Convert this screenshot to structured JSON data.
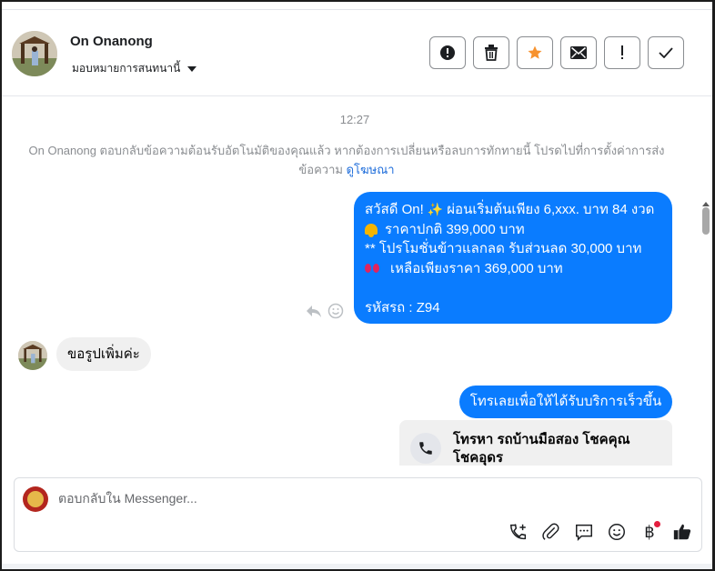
{
  "header": {
    "contact_name": "On Onanong",
    "assign_label": "มอบหมายการสนทนานี้"
  },
  "actions": [
    {
      "name": "spam-button",
      "icon": "alert-circle-icon"
    },
    {
      "name": "delete-button",
      "icon": "trash-icon"
    },
    {
      "name": "star-button",
      "icon": "star-icon"
    },
    {
      "name": "mark-unread-button",
      "icon": "envelope-icon"
    },
    {
      "name": "follow-up-button",
      "icon": "exclamation-icon"
    },
    {
      "name": "done-button",
      "icon": "checkmark-icon"
    }
  ],
  "conversation": {
    "timestamp": "12:27",
    "system_message": "On Onanong ตอบกลับข้อความต้อนรับอัตโนมัติของคุณแล้ว หากต้องการเปลี่ยนหรือลบการทักทายนี้ โปรดไปที่การตั้งค่าการส่งข้อความ",
    "system_link": "ดูโฆษณา",
    "outgoing_1": {
      "line1": "สวัสดี On!",
      "line1_rest": " ผ่อนเริ่มต้นเพียง 6,xxx. บาท 84 งวด",
      "line2": "ราคาปกติ 399,000 บาท",
      "line3": "** โปรโมชั่นข้าวแลกลด รับส่วนลด 30,000 บาท",
      "line4": "เหลือเพียงราคา 369,000 บาท",
      "line5": "รหัสรถ : Z94"
    },
    "incoming_1": "ขอรูปเพิ่มค่ะ",
    "outgoing_2": "โทรเลยเพื่อให้ได้รับบริการเร็วขึ้น",
    "call_card": "โทรหา รถบ้านมือสอง โชคคุณ โชคอุดร"
  },
  "composer": {
    "placeholder": "ตอบกลับใน Messenger...",
    "tools": [
      "add-call-icon",
      "paperclip-icon",
      "saved-reply-icon",
      "emoji-icon",
      "baht-payment-icon",
      "thumbs-up-icon"
    ],
    "baht_symbol": "฿"
  },
  "colors": {
    "outgoing_bubble": "#0a7cff",
    "incoming_bubble": "#f0f0f0",
    "star": "#f7922e",
    "link": "#216fdb"
  }
}
